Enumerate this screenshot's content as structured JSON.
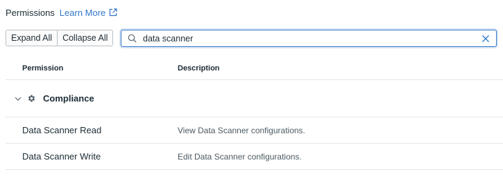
{
  "header": {
    "title": "Permissions",
    "learn_more": "Learn More"
  },
  "toolbar": {
    "expand_all": "Expand All",
    "collapse_all": "Collapse All"
  },
  "search": {
    "value": "data scanner",
    "placeholder": ""
  },
  "table": {
    "columns": [
      "Permission",
      "Description"
    ],
    "group": {
      "name": "Compliance",
      "icon": "gear-icon",
      "expanded": true
    },
    "rows": [
      {
        "permission": "Data Scanner Read",
        "description": "View Data Scanner configurations."
      },
      {
        "permission": "Data Scanner Write",
        "description": "Edit Data Scanner configurations."
      }
    ]
  },
  "colors": {
    "accent": "#3277c9",
    "text": "#1c2b34",
    "muted_text": "#4d5a63",
    "border": "#e2e6e9"
  }
}
